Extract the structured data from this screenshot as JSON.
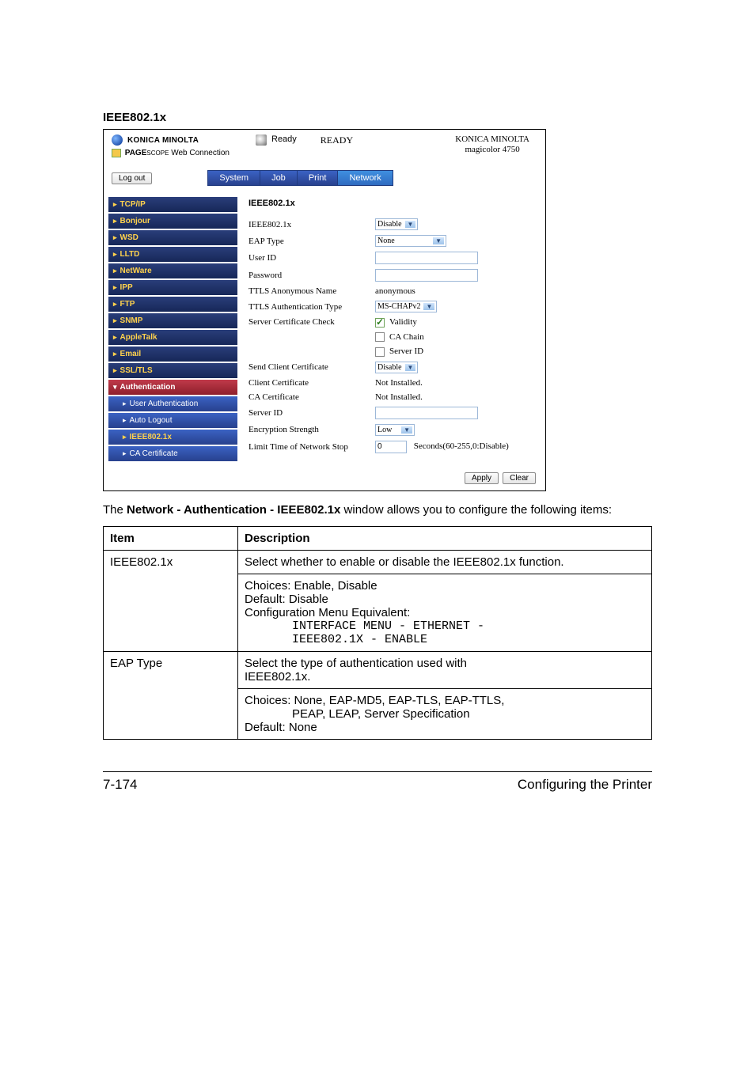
{
  "title": "IEEE802.1x",
  "shot": {
    "brand": "KONICA MINOLTA",
    "pagescope": "Web Connection",
    "ready_small": "Ready",
    "ready_big": "READY",
    "model_line1": "KONICA MINOLTA",
    "model_line2": "magicolor 4750",
    "logout": "Log out",
    "tabs": {
      "system": "System",
      "job": "Job",
      "print": "Print",
      "network": "Network"
    },
    "side": {
      "tcpip": "TCP/IP",
      "bonjour": "Bonjour",
      "wsd": "WSD",
      "lltd": "LLTD",
      "netware": "NetWare",
      "ipp": "IPP",
      "ftp": "FTP",
      "snmp": "SNMP",
      "appletalk": "AppleTalk",
      "email": "Email",
      "ssltls": "SSL/TLS",
      "auth": "Authentication",
      "userauth": "User Authentication",
      "autologout": "Auto Logout",
      "ieee": "IEEE802.1x",
      "cacert": "CA Certificate"
    },
    "pane": {
      "heading": "IEEE802.1x",
      "labels": {
        "ieee": "IEEE802.1x",
        "eaptype": "EAP Type",
        "userid": "User ID",
        "password": "Password",
        "ttls_anon": "TTLS Anonymous Name",
        "ttls_auth": "TTLS Authentication Type",
        "servcheck": "Server Certificate Check",
        "sendclient": "Send Client Certificate",
        "clientcert": "Client Certificate",
        "cacert": "CA Certificate",
        "serverid": "Server ID",
        "encstrength": "Encryption Strength",
        "limit": "Limit Time of Network Stop"
      },
      "values": {
        "ieee": "Disable",
        "eaptype": "None",
        "ttls_anon": "anonymous",
        "ttls_auth": "MS-CHAPv2",
        "validity": "Validity",
        "cachain": "CA Chain",
        "serverid_cb": "Server ID",
        "sendclient": "Disable",
        "clientcert": "Not Installed.",
        "cacert": "Not Installed.",
        "encstrength": "Low",
        "limit_val": "0",
        "limit_unit": "Seconds(60-255,0:Disable)"
      },
      "apply": "Apply",
      "clear": "Clear"
    }
  },
  "intro_pre": "The ",
  "intro_bold": "Network - Authentication - IEEE802.1x",
  "intro_post": " window allows you to configure the following items:",
  "table": {
    "h_item": "Item",
    "h_desc": "Description",
    "row1": {
      "item": "IEEE802.1x",
      "p1": "Select whether to enable or disable the IEEE802.1x function.",
      "choices": "Choices: Enable, Disable",
      "default": "Default:  Disable",
      "cfg": "Configuration Menu Equivalent:",
      "mono1": "INTERFACE MENU - ETHERNET -",
      "mono2": "IEEE802.1X - ENABLE"
    },
    "row2": {
      "item": "EAP Type",
      "p1a": "Select the type of authentication used with ",
      "p1b": "IEEE802.1x.",
      "choices1": "Choices: None, EAP-MD5, EAP-TLS, EAP-TTLS, ",
      "choices2": "PEAP, LEAP, Server Specification",
      "default": "Default:  None"
    }
  },
  "footer": {
    "page": "7-174",
    "section": "Configuring the Printer"
  }
}
